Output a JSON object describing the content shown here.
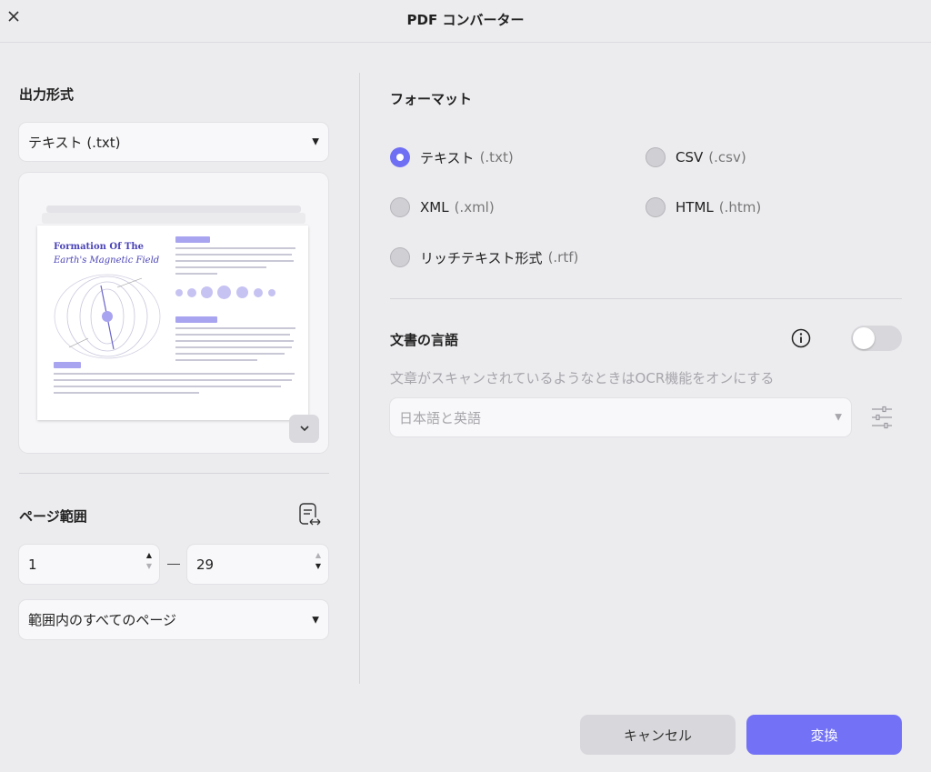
{
  "window": {
    "title": "PDF コンバーター"
  },
  "left": {
    "output_format": {
      "heading": "出力形式",
      "selected": "テキスト (.txt)"
    },
    "preview": {
      "doc_title_line1": "Formation Of The",
      "doc_title_line2": "Earth's Magnetic Field"
    },
    "page_range": {
      "heading": "ページ範囲",
      "from": "1",
      "to": "29",
      "scope": "範囲内のすべてのページ"
    }
  },
  "right": {
    "format": {
      "heading": "フォーマット",
      "options": [
        {
          "label": "テキスト",
          "ext": "(.txt)",
          "selected": true
        },
        {
          "label": "CSV",
          "ext": "(.csv)",
          "selected": false
        },
        {
          "label": "XML",
          "ext": "(.xml)",
          "selected": false
        },
        {
          "label": "HTML",
          "ext": "(.htm)",
          "selected": false
        },
        {
          "label": "リッチテキスト形式",
          "ext": "(.rtf)",
          "selected": false
        }
      ]
    },
    "language": {
      "heading": "文書の言語",
      "hint": "文章がスキャンされているようなときはOCR機能をオンにする",
      "selected": "日本語と英語",
      "ocr_enabled": false
    }
  },
  "footer": {
    "cancel_label": "キャンセル",
    "convert_label": "変換"
  },
  "colors": {
    "accent": "#7372f6",
    "background": "#ececef"
  }
}
